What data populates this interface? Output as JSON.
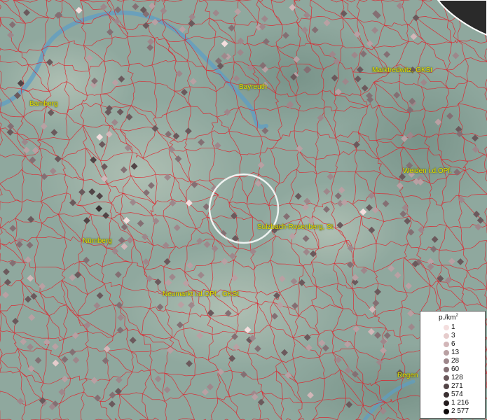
{
  "cities": [
    {
      "name": "Bamberg"
    },
    {
      "name": "Bayreuth"
    },
    {
      "name": "Marktredwitz, GKSt"
    },
    {
      "name": "Weiden i.d.OPf."
    },
    {
      "name": "Sulzbach-Rosenberg, St"
    },
    {
      "name": "Nürnberg"
    },
    {
      "name": "Neumarkt i.d.OPf., GKSt"
    },
    {
      "name": "Regen"
    }
  ],
  "legend": {
    "title": "p./km",
    "title_sup": "2",
    "classes": [
      {
        "label": "1",
        "color": "#f4dede"
      },
      {
        "label": "3",
        "color": "#e6cccc"
      },
      {
        "label": "6",
        "color": "#d2b6b8"
      },
      {
        "label": "13",
        "color": "#b9a0a3"
      },
      {
        "label": "28",
        "color": "#9e878b"
      },
      {
        "label": "60",
        "color": "#846f73"
      },
      {
        "label": "128",
        "color": "#6b595c"
      },
      {
        "label": "271",
        "color": "#524446"
      },
      {
        "label": "574",
        "color": "#3b3032"
      },
      {
        "label": "1 216",
        "color": "#251e1f"
      },
      {
        "label": "2 577",
        "color": "#0d0a0a"
      }
    ]
  },
  "colors": {
    "boundary": "#e0202a",
    "river": "#5d9ec4",
    "label": "#e8e000",
    "terrain": "#8fa89e"
  }
}
